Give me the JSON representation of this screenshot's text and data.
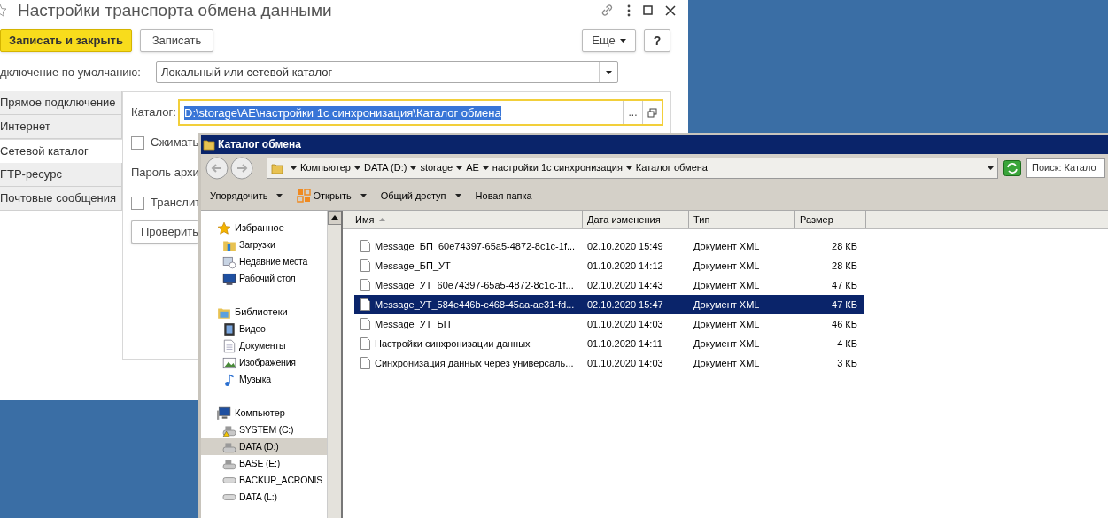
{
  "settings_window": {
    "title": "Настройки транспорта обмена данными",
    "buttons": [
      {
        "label": "Записать и закрыть",
        "kind": "primary"
      },
      {
        "label": "Записать",
        "kind": "normal"
      }
    ],
    "more_button": "Еще",
    "help_button": "?",
    "default_connection": {
      "label": "дключение по умолчанию:",
      "value": "Локальный или сетевой каталог"
    },
    "tabs": [
      {
        "label": "Прямое подключение",
        "selected": false
      },
      {
        "label": "Интернет",
        "selected": false
      },
      {
        "label": "Сетевой каталог",
        "selected": true
      },
      {
        "label": "FTP-ресурс",
        "selected": false
      },
      {
        "label": "Почтовые сообщения",
        "selected": false
      }
    ],
    "catalog": {
      "label": "Каталог:",
      "value": "D:\\storage\\AE\\настройки 1с синхронизация\\Каталог обмена",
      "text_selected": true,
      "browse_button": "..."
    },
    "options": [
      {
        "kind": "checkbox",
        "label": "Сжимать",
        "checked": false
      },
      {
        "kind": "label",
        "label": "Пароль архи"
      },
      {
        "kind": "checkbox",
        "label": "Транслит",
        "checked": false
      },
      {
        "kind": "button",
        "label": "Проверить"
      }
    ]
  },
  "explorer": {
    "title": "Каталог обмена",
    "breadcrumbs": [
      "Компьютер",
      "DATA (D:)",
      "storage",
      "AE",
      "настройки 1с синхронизация",
      "Каталог обмена"
    ],
    "search": {
      "placeholder": "Поиск: Катало"
    },
    "toolbar": [
      {
        "label": "Упорядочить",
        "kind": "menu"
      },
      {
        "label": "Открыть",
        "kind": "open"
      },
      {
        "label": "Общий доступ",
        "kind": "menu"
      },
      {
        "label": "Новая папка",
        "kind": "plain"
      }
    ],
    "nav": [
      {
        "label": "Избранное",
        "children": [
          {
            "label": "Загрузки",
            "selected": false
          },
          {
            "label": "Недавние места",
            "selected": false
          },
          {
            "label": "Рабочий стол",
            "selected": false
          }
        ]
      },
      {
        "label": "Библиотеки",
        "children": [
          {
            "label": "Видео",
            "selected": false
          },
          {
            "label": "Документы",
            "selected": false
          },
          {
            "label": "Изображения",
            "selected": false
          },
          {
            "label": "Музыка",
            "selected": false
          }
        ]
      },
      {
        "label": "Компьютер",
        "children": [
          {
            "label": "SYSTEM (C:)",
            "selected": false
          },
          {
            "label": "DATA (D:)",
            "selected": true
          },
          {
            "label": "BASE (E:)",
            "selected": false
          },
          {
            "label": "BACKUP_ACRONIS",
            "selected": false
          },
          {
            "label": "DATA (L:)",
            "selected": false
          }
        ]
      }
    ],
    "columns": [
      {
        "label": "Имя",
        "sorted": true
      },
      {
        "label": "Дата изменения",
        "sorted": false
      },
      {
        "label": "Тип",
        "sorted": false
      },
      {
        "label": "Размер",
        "sorted": false
      }
    ],
    "files": [
      {
        "name": "Message_БП_60e74397-65a5-4872-8c1c-1f...",
        "date": "02.10.2020 15:49",
        "type": "Документ XML",
        "size": "28 КБ",
        "selected": false
      },
      {
        "name": "Message_БП_УТ",
        "date": "01.10.2020 14:12",
        "type": "Документ XML",
        "size": "28 КБ",
        "selected": false
      },
      {
        "name": "Message_УТ_60e74397-65a5-4872-8c1c-1f...",
        "date": "02.10.2020 14:43",
        "type": "Документ XML",
        "size": "47 КБ",
        "selected": false
      },
      {
        "name": "Message_УТ_584e446b-c468-45aa-ae31-fd...",
        "date": "02.10.2020 15:47",
        "type": "Документ XML",
        "size": "47 КБ",
        "selected": true
      },
      {
        "name": "Message_УТ_БП",
        "date": "01.10.2020 14:03",
        "type": "Документ XML",
        "size": "46 КБ",
        "selected": false
      },
      {
        "name": "Настройки синхронизации данных",
        "date": "01.10.2020 14:11",
        "type": "Документ XML",
        "size": "4 КБ",
        "selected": false
      },
      {
        "name": "Синхронизация данных через универсаль...",
        "date": "01.10.2020 14:03",
        "type": "Документ XML",
        "size": "3 КБ",
        "selected": false
      }
    ]
  }
}
